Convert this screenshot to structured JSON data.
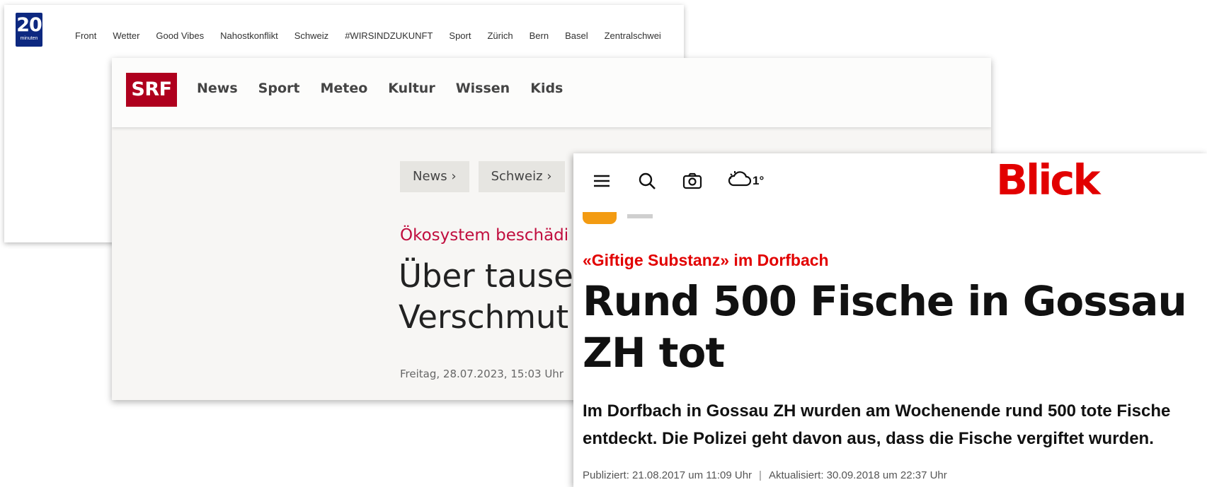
{
  "twenty_minuten": {
    "logo_number": "20",
    "logo_subtitle": "minuten",
    "nav": [
      "Front",
      "Wetter",
      "Good Vibes",
      "Nahostkonflikt",
      "Schweiz",
      "#WIRSINDZUKUNFT",
      "Sport",
      "Zürich",
      "Bern",
      "Basel",
      "Zentralschwei"
    ]
  },
  "srf": {
    "logo": "SRF",
    "nav": [
      "News",
      "Sport",
      "Meteo",
      "Kultur",
      "Wissen",
      "Kids"
    ],
    "breadcrumb": [
      "News",
      "Schweiz"
    ],
    "kicker": "Ökosystem beschädi",
    "title_line1": "Über tause",
    "title_line2": "Verschmut",
    "date": "Freitag, 28.07.2023, 15:03 Uhr"
  },
  "blick": {
    "logo": "Blick",
    "weather_temp": "1°",
    "icons": [
      "menu-icon",
      "search-icon",
      "camera-icon",
      "weather-icon"
    ],
    "kicker": "«Giftige Substanz» im Dorfbach",
    "title": "Rund 500 Fische in Gossau ZH tot",
    "lead": "Im Dorfbach in Gossau ZH wurden am Wochenende rund 500 tote Fische entdeckt. Die Polizei geht davon aus, dass die Fische vergiftet wurden.",
    "published": "Publiziert: 21.08.2017 um 11:09 Uhr",
    "separator": "|",
    "updated": "Aktualisiert: 30.09.2018 um 22:37 Uhr",
    "colors": {
      "brand": "#e20000",
      "badge": "#f39b12"
    }
  }
}
